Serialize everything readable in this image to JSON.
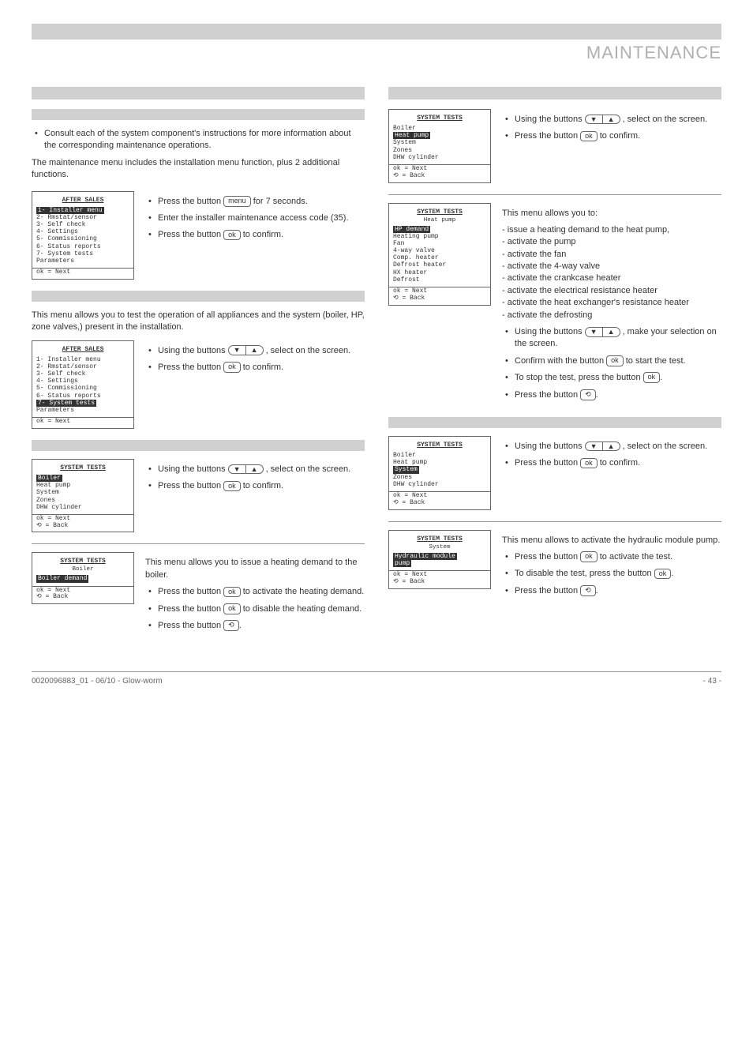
{
  "header": {
    "title": "MAINTENANCE"
  },
  "key_labels": {
    "ok": "ok",
    "menu": "menu",
    "back": "⟲"
  },
  "intro": {
    "note": "Consult each of the system component's instructions for more information about the corresponding maintenance operations.",
    "desc": "The maintenance menu includes the installation menu function, plus 2 additional functions."
  },
  "lcd_after_sales_1": {
    "title": "AFTER SALES",
    "items": [
      "1- Installer menu",
      "2- Rmstat/sensor",
      "3- Self check",
      "4- Settings",
      "5- Commissioning",
      "6- Status reports",
      "7- System tests",
      "Parameters"
    ],
    "sel_index": 0,
    "foot": [
      "ok  = Next"
    ]
  },
  "after_sales_inst": {
    "l1a": "Press the button ",
    "l1b": " for 7 seconds.",
    "l2": "Enter the installer maintenance access code (35).",
    "l3a": "Press the button ",
    "l3b": " to confirm."
  },
  "section_tests_desc": "This menu allows you to test the operation of all appliances and the system (boiler, HP, zone valves,) present in the installation.",
  "lcd_after_sales_2": {
    "title": "AFTER SALES",
    "items": [
      "1- Installer menu",
      "2- Rmstat/sensor",
      "3- Self check",
      "4- Settings",
      "5- Commissioning",
      "6- Status reports",
      "7- System tests",
      "Parameters"
    ],
    "sel_index": 6,
    "foot": [
      "ok  = Next"
    ]
  },
  "after_sales_sel": {
    "l1a": "Using the buttons ",
    "l1b": " , select ",
    "l1c": " on the screen.",
    "l2a": "Press the button ",
    "l2b": " to confirm."
  },
  "lcd_st_boiler": {
    "title": "SYSTEM TESTS",
    "items": [
      "Boiler",
      "Heat pump",
      "System",
      "Zones",
      "DHW cylinder"
    ],
    "sel_index": 0,
    "foot": [
      "ok  = Next",
      "⟲   = Back"
    ]
  },
  "boiler_sel": {
    "l1a": "Using the buttons ",
    "l1b": " , select ",
    "l1c": " on the screen.",
    "l2a": "Press the button ",
    "l2b": " to confirm."
  },
  "boiler_demand_intro": "This menu allows you to issue a heating demand to the boiler.",
  "lcd_boiler_demand": {
    "title": "SYSTEM TESTS",
    "subtitle": "Boiler",
    "items": [
      "Boiler demand"
    ],
    "sel_index": 0,
    "foot": [
      "ok  = Next",
      "⟲   = Back"
    ]
  },
  "boiler_demand_inst": {
    "l1a": "Press the button ",
    "l1b": " to activate the heating demand.",
    "l2a": "Press the button ",
    "l2b": " to disable the heating demand.",
    "l3a": "Press the button ",
    "l3b": "."
  },
  "lcd_st_hp": {
    "title": "SYSTEM TESTS",
    "items": [
      "Boiler",
      "Heat pump",
      "System",
      "Zones",
      "DHW cylinder"
    ],
    "sel_index": 1,
    "foot": [
      "ok  = Next",
      "⟲   = Back"
    ]
  },
  "hp_sel": {
    "l1a": "Using the buttons ",
    "l1b": " , select ",
    "l1c": " on the screen.",
    "l2a": "Press the button ",
    "l2b": " to confirm."
  },
  "hp_menu_intro": "This menu allows you to:",
  "hp_menu_lines": [
    "- issue a heating demand to the heat pump,",
    "- activate the pump",
    "- activate the fan",
    "- activate the 4-way valve",
    "- activate the crankcase heater",
    "- activate the electrical resistance heater",
    "- activate the heat exchanger's resistance heater",
    "- activate the defrosting"
  ],
  "lcd_hp_sub": {
    "title": "SYSTEM TESTS",
    "subtitle": "Heat pump",
    "items": [
      "HP demand",
      "Heating pump",
      "Fan",
      "4-way valve",
      "Comp. heater",
      "Defrost heater",
      "HX heater",
      "Defrost"
    ],
    "sel_index": 0,
    "foot": [
      "ok  = Next",
      "⟲   = Back"
    ]
  },
  "hp_inst": {
    "l1a": "Using the buttons ",
    "l1b": " , make your selection on the screen.",
    "l2a": "Confirm with the button ",
    "l2b": " to start the test.",
    "l3a": "To stop the test, press the button ",
    "l3b": ".",
    "l4a": "Press the button ",
    "l4b": "."
  },
  "lcd_st_system": {
    "title": "SYSTEM TESTS",
    "items": [
      "Boiler",
      "Heat pump",
      "System",
      "Zones",
      "DHW cylinder"
    ],
    "sel_index": 2,
    "foot": [
      "ok  = Next",
      "⟲   = Back"
    ]
  },
  "system_sel": {
    "l1a": "Using the buttons ",
    "l1b": " , select ",
    "l1c": " on the screen.",
    "l2a": "Press the button ",
    "l2b": " to confirm."
  },
  "system_sub_intro": "This menu allows to activate the hydraulic module pump.",
  "lcd_sys_sub": {
    "title": "SYSTEM TESTS",
    "subtitle": "System",
    "items": [
      "Hydraulic module",
      "pump"
    ],
    "sel_index": 0,
    "sel_span": 2,
    "foot": [
      "ok  = Next",
      "⟲   = Back"
    ]
  },
  "system_inst": {
    "l1a": "Press the button ",
    "l1b": " to activate the test.",
    "l2a": "To disable the test, press the button ",
    "l2b": ".",
    "l3a": "Press the button ",
    "l3b": "."
  },
  "footer": {
    "left": "0020096883_01 - 06/10 - Glow-worm",
    "right": "- 43 -"
  }
}
